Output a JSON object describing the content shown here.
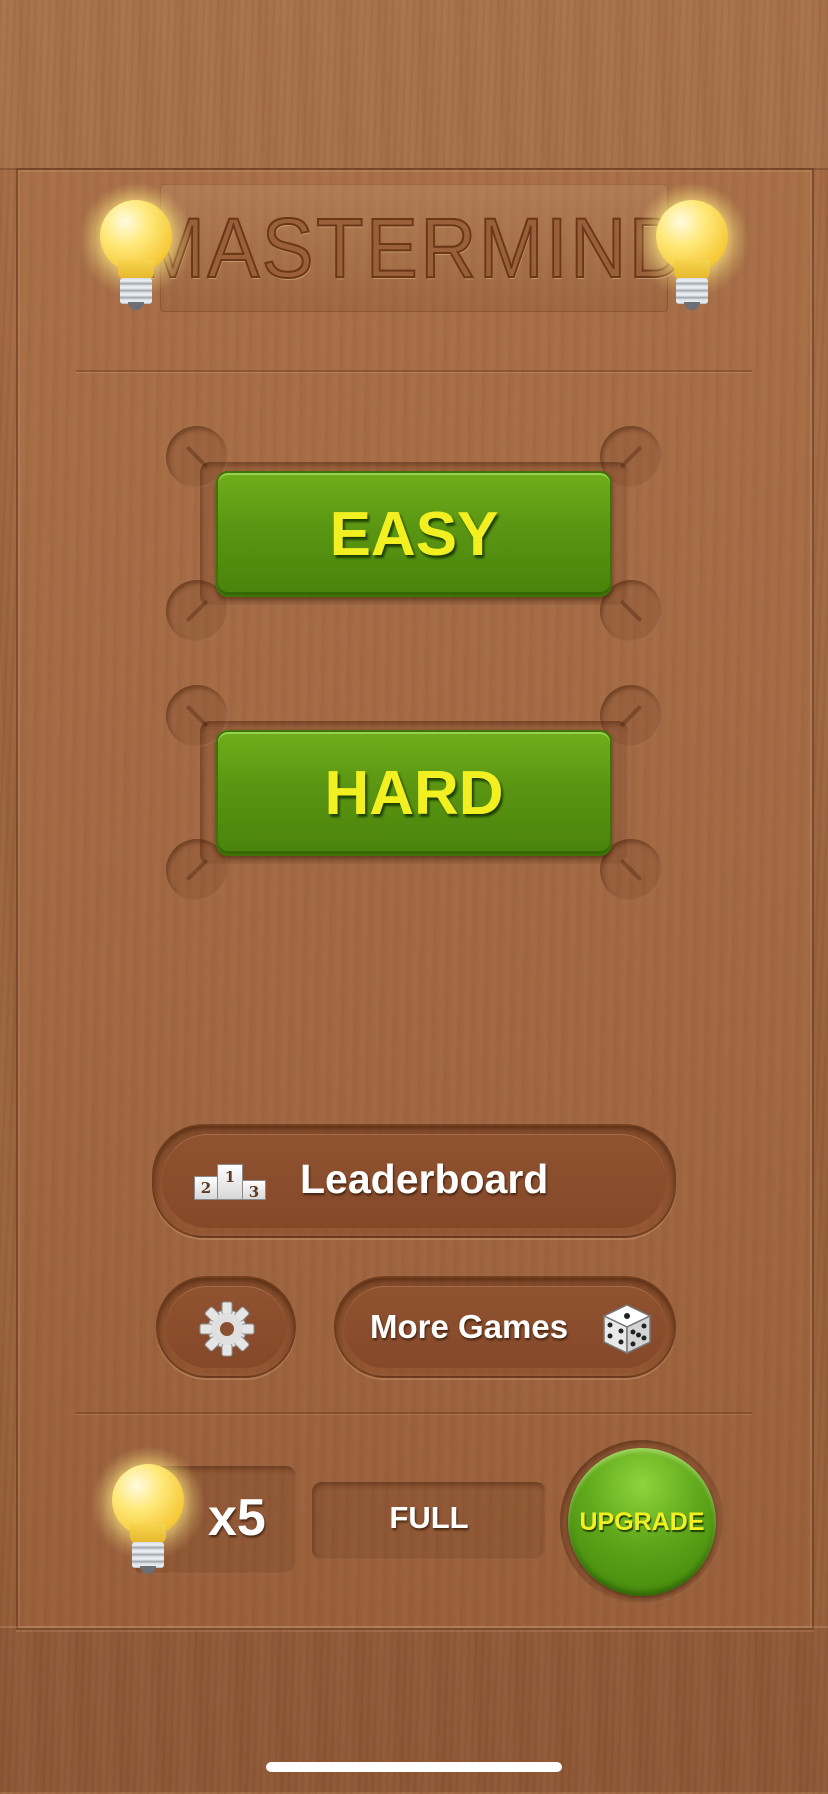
{
  "app": {
    "title": "MASTERMIND"
  },
  "difficulty": {
    "easy_label": "EASY",
    "hard_label": "HARD"
  },
  "menu": {
    "leaderboard_label": "Leaderboard",
    "more_games_label": "More Games",
    "leaderboard_icon": "podium-icon",
    "settings_icon": "gear-icon",
    "more_games_icon": "dice-icon"
  },
  "hints": {
    "count_label": "x5",
    "status_label": "FULL",
    "icon": "lightbulb-icon"
  },
  "upgrade": {
    "label": "UPGRADE"
  },
  "colors": {
    "button_green": "#5a9612",
    "button_text_yellow": "#f3f022",
    "wood": "#a16742"
  }
}
